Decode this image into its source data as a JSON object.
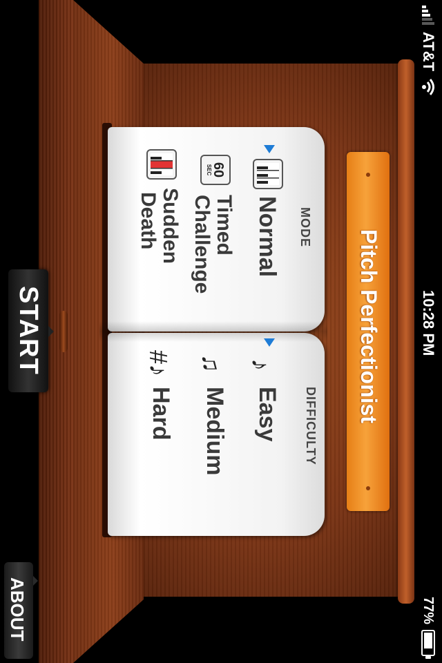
{
  "status_bar": {
    "carrier": "AT&T",
    "time": "10:28 PM",
    "battery_percent": "77%",
    "battery_level": 0.77,
    "icons": [
      "signal-icon",
      "wifi-icon",
      "battery-icon"
    ]
  },
  "title": "Pitch Perfectionist",
  "book": {
    "mode": {
      "heading": "MODE",
      "selected": "Normal",
      "options": [
        {
          "label": "Normal",
          "icon": "piano-keys-icon",
          "selected": true
        },
        {
          "label_line1": "Timed",
          "label_line2": "Challenge",
          "icon": "60-sec-timer-icon",
          "icon_text": "60",
          "icon_subtext": "SEC"
        },
        {
          "label_line1": "Sudden",
          "label_line2": "Death",
          "icon": "red-piano-key-icon"
        }
      ]
    },
    "difficulty": {
      "heading": "DIFFICULTY",
      "selected": "Easy",
      "options": [
        {
          "label": "Easy",
          "icon": "eighth-note-icon",
          "glyph": "♪",
          "selected": true
        },
        {
          "label": "Medium",
          "icon": "beamed-notes-icon",
          "glyph": "♫"
        },
        {
          "label": "Hard",
          "icon": "sharp-note-icon",
          "glyph": "#♪"
        }
      ]
    }
  },
  "buttons": {
    "start": "START",
    "about": "ABOUT"
  },
  "colors": {
    "accent_marker": "#1e7cd6",
    "plank": "#f09a2e",
    "wood": "#8a3c18"
  }
}
